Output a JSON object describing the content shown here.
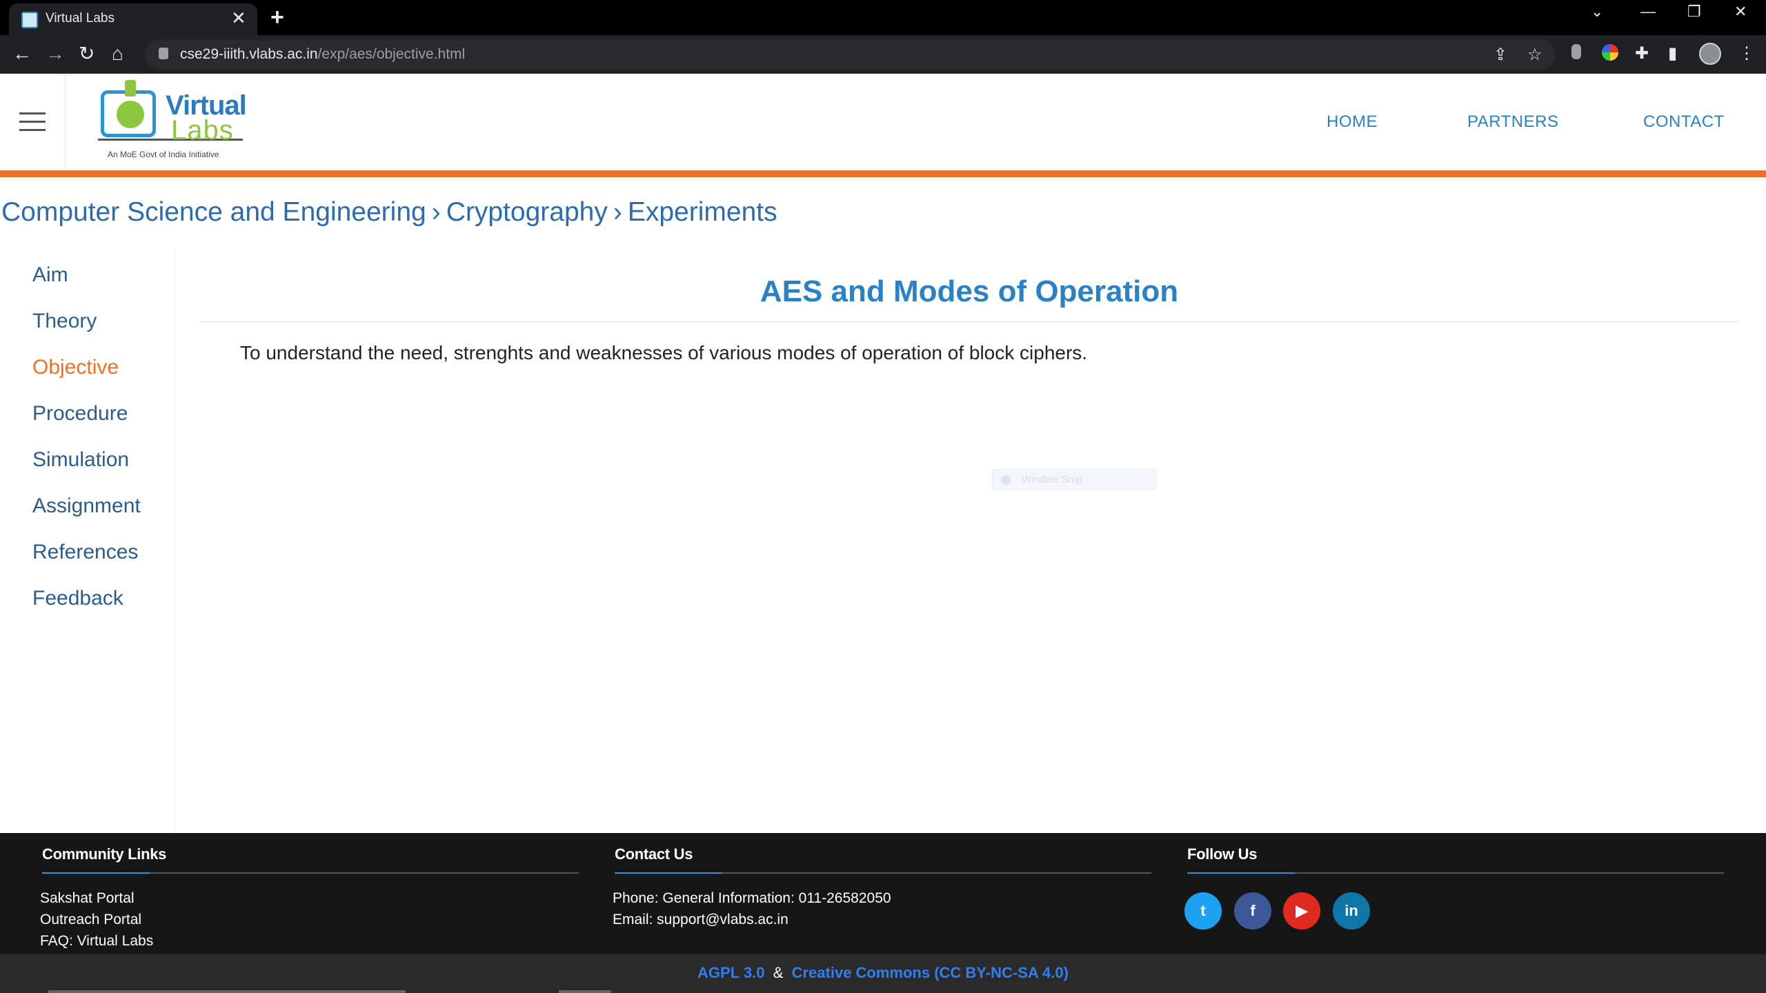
{
  "browser": {
    "tab_title": "Virtual Labs",
    "tab_close": "✕",
    "new_tab": "+",
    "url_host": "cse29-iiith.vlabs.ac.in",
    "url_path": "/exp/aes/objective.html",
    "icons": {
      "back": "←",
      "forward": "→",
      "reload": "↻",
      "home": "⌂",
      "share": "⇪",
      "star": "☆",
      "extensions": "✚",
      "sidepanel": "▮",
      "menu": "⋮",
      "minimize": "—",
      "restore": "❐",
      "close": "✕",
      "tabsearch": "⌄"
    }
  },
  "header": {
    "logo_line1": "Virtual",
    "logo_line2": "Labs",
    "logo_tagline": "An MoE Govt of India Initiative",
    "nav": [
      "HOME",
      "PARTNERS",
      "CONTACT"
    ]
  },
  "breadcrumb": {
    "items": [
      "Computer Science and Engineering",
      "Cryptography",
      "Experiments"
    ],
    "separator": "›"
  },
  "sidebar": {
    "items": [
      "Aim",
      "Theory",
      "Objective",
      "Procedure",
      "Simulation",
      "Assignment",
      "References",
      "Feedback"
    ],
    "active": "Objective"
  },
  "main": {
    "title": "AES and Modes of Operation",
    "text": "To understand the need, strenghts and weaknesses of various modes of operation of block ciphers.",
    "ghost_overlay": "Window Snip"
  },
  "footer": {
    "community_heading": "Community Links",
    "community_links": [
      "Sakshat Portal",
      "Outreach Portal",
      "FAQ: Virtual Labs"
    ],
    "contact_heading": "Contact Us",
    "contact_phone": "Phone: General Information: 011-26582050",
    "contact_email": "Email: support@vlabs.ac.in",
    "follow_heading": "Follow Us",
    "social": [
      {
        "name": "twitter",
        "glyph": "t",
        "color": "#1da1f2"
      },
      {
        "name": "facebook",
        "glyph": "f",
        "color": "#3b5998"
      },
      {
        "name": "youtube",
        "glyph": "▶",
        "color": "#e02a20"
      },
      {
        "name": "linkedin",
        "glyph": "in",
        "color": "#0e76a8"
      }
    ],
    "license_1": "AGPL 3.0",
    "license_amp": "&",
    "license_2": "Creative Commons (CC BY-NC-SA 4.0)"
  },
  "colors": {
    "accent_orange": "#f36f21",
    "link_blue": "#2a82c6",
    "footer_bg": "#161616"
  }
}
